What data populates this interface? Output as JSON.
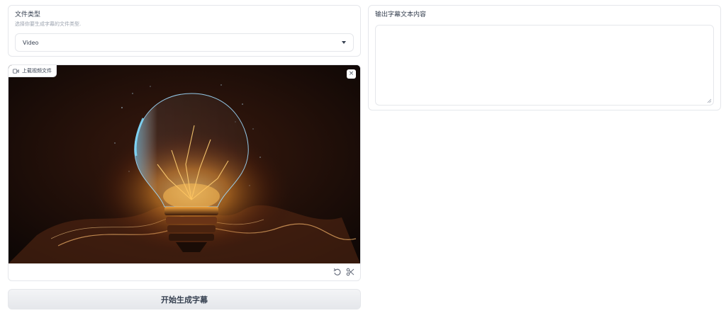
{
  "file_type": {
    "label": "文件类型",
    "info": "选择你要生成字幕的文件类型.",
    "selected": "Video"
  },
  "video": {
    "label": "上载视频文件",
    "clear_symbol": "×"
  },
  "actions": {
    "generate_label": "开始生成字幕"
  },
  "output": {
    "label": "输出字幕文本内容",
    "value": ""
  },
  "icons": {
    "video_label_icon": "video-camera-icon",
    "clear_icon": "close-icon",
    "undo_icon": "undo-icon",
    "trim_icon": "scissors-icon",
    "dropdown_icon": "chevron-down-icon"
  },
  "colors": {
    "border": "#e5e7eb",
    "button_bg": "#f3f4f6",
    "video_bg": "#150b08"
  }
}
